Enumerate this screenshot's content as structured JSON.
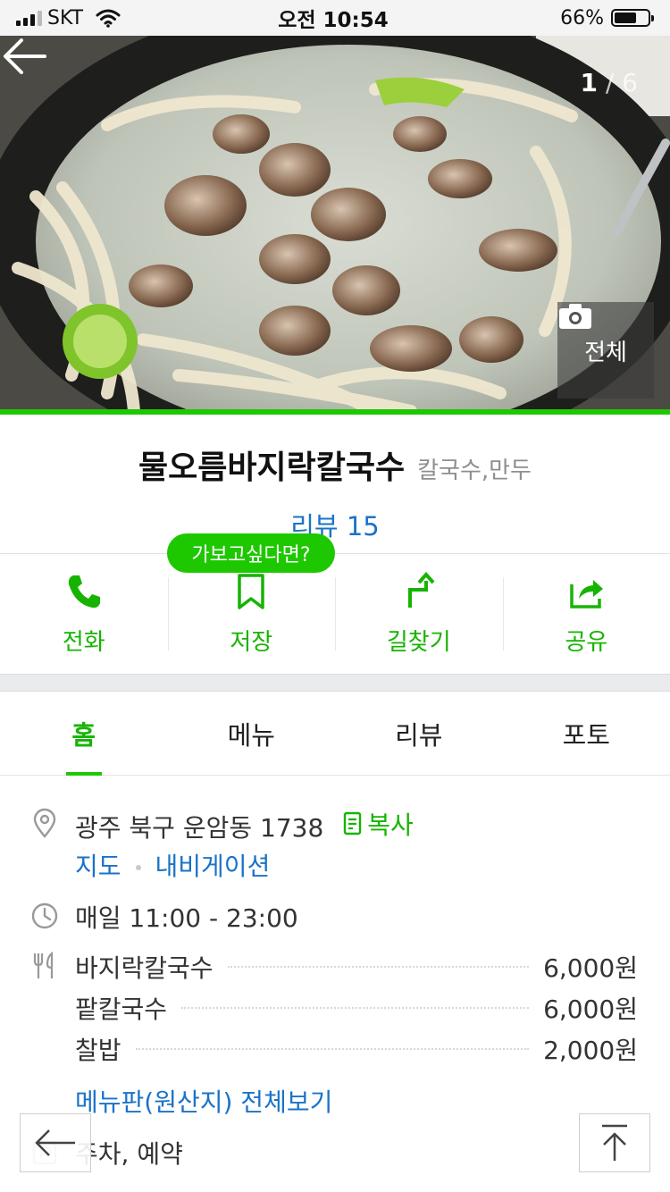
{
  "status_bar": {
    "carrier": "SKT",
    "time": "오전 10:54",
    "battery": "66%",
    "battery_level": 0.66
  },
  "hero": {
    "counter_current": "1",
    "counter_sep": "/",
    "counter_total": "6",
    "all_photos_label": "전체"
  },
  "place": {
    "name": "물오름바지락칼국수",
    "category": "칼국수,만두",
    "review_link": "리뷰 15"
  },
  "tooltip": "가보고싶다면?",
  "actions": [
    {
      "label": "전화",
      "icon": "phone-icon"
    },
    {
      "label": "저장",
      "icon": "bookmark-icon"
    },
    {
      "label": "길찾기",
      "icon": "directions-icon"
    },
    {
      "label": "공유",
      "icon": "share-icon"
    }
  ],
  "tabs": [
    "홈",
    "메뉴",
    "리뷰",
    "포토"
  ],
  "active_tab": "홈",
  "info": {
    "address": "광주 북구 운암동 1738",
    "copy_label": "복사",
    "map_link": "지도",
    "navigation_link": "내비게이션",
    "hours": "매일 11:00 - 23:00",
    "menu": [
      {
        "name": "바지락칼국수",
        "price": "6,000원"
      },
      {
        "name": "팥칼국수",
        "price": "6,000원"
      },
      {
        "name": "찰밥",
        "price": "2,000원"
      }
    ],
    "menu_full_link": "메뉴판(원산지) 전체보기",
    "facilities": "주차, 예약"
  },
  "colors": {
    "accent": "#1ec800",
    "link": "#1a73c8",
    "muted": "#8e8e8e"
  }
}
